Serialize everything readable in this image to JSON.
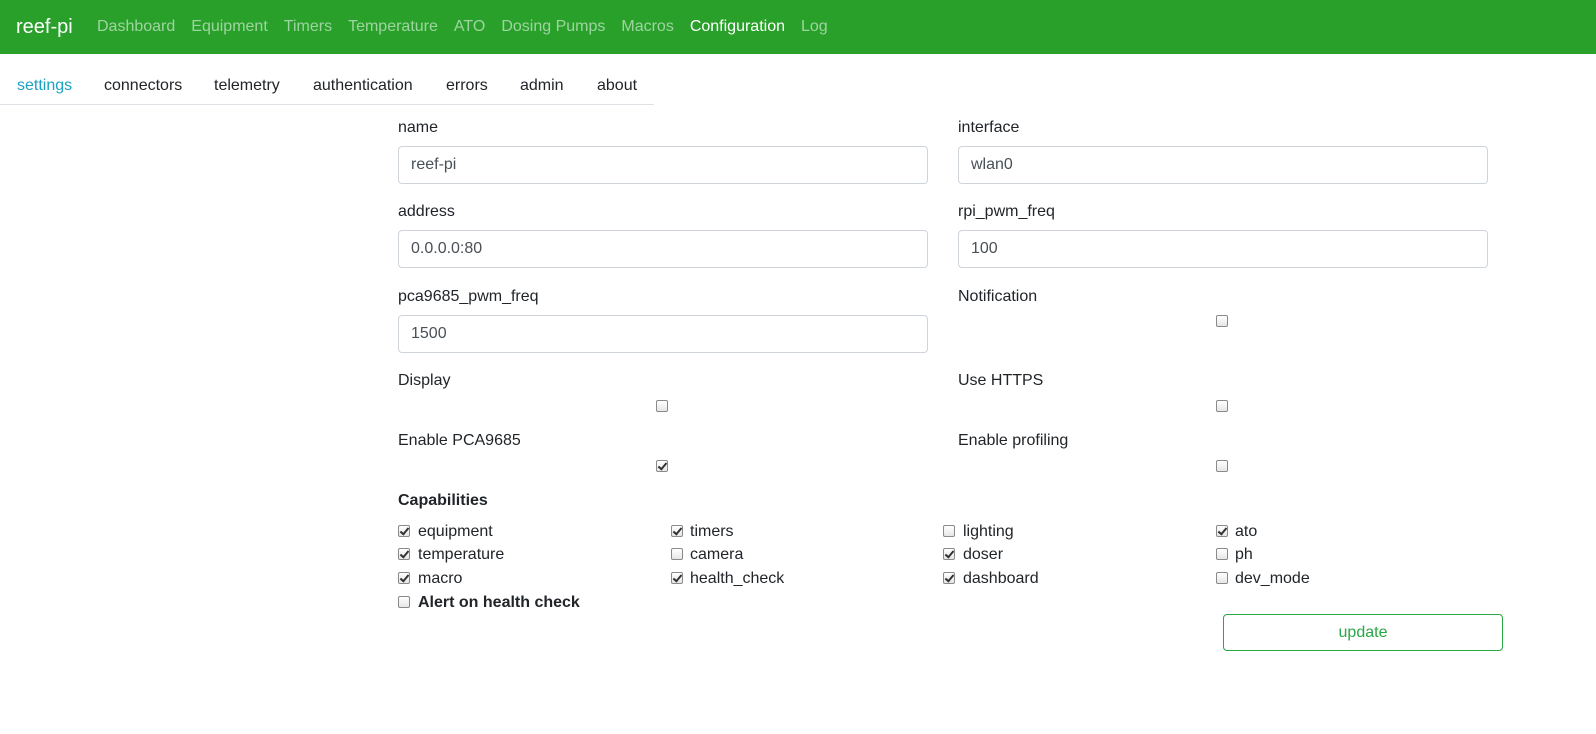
{
  "app": {
    "brand": "reef-pi",
    "nav": [
      "Dashboard",
      "Equipment",
      "Timers",
      "Temperature",
      "ATO",
      "Dosing Pumps",
      "Macros",
      "Configuration",
      "Log"
    ],
    "active_nav": "Configuration"
  },
  "tabs": {
    "items": [
      "settings",
      "connectors",
      "telemetry",
      "authentication",
      "errors",
      "admin",
      "about"
    ],
    "active": "settings"
  },
  "form": {
    "name": {
      "label": "name",
      "value": "reef-pi"
    },
    "interface": {
      "label": "interface",
      "value": "wlan0"
    },
    "address": {
      "label": "address",
      "value": "0.0.0.0:80"
    },
    "rpi_pwm_freq": {
      "label": "rpi_pwm_freq",
      "value": "100"
    },
    "pca9685_pwm_freq": {
      "label": "pca9685_pwm_freq",
      "value": "1500"
    },
    "notification": {
      "label": "Notification",
      "checked": false
    },
    "display": {
      "label": "Display",
      "checked": false
    },
    "use_https": {
      "label": "Use HTTPS",
      "checked": false
    },
    "enable_pca9685": {
      "label": "Enable PCA9685",
      "checked": true
    },
    "enable_profiling": {
      "label": "Enable profiling",
      "checked": false
    }
  },
  "capabilities": {
    "title": "Capabilities",
    "items": [
      {
        "label": "equipment",
        "checked": true
      },
      {
        "label": "timers",
        "checked": true
      },
      {
        "label": "lighting",
        "checked": false
      },
      {
        "label": "ato",
        "checked": true
      },
      {
        "label": "temperature",
        "checked": true
      },
      {
        "label": "camera",
        "checked": false
      },
      {
        "label": "doser",
        "checked": true
      },
      {
        "label": "ph",
        "checked": false
      },
      {
        "label": "macro",
        "checked": true
      },
      {
        "label": "health_check",
        "checked": true
      },
      {
        "label": "dashboard",
        "checked": true
      },
      {
        "label": "dev_mode",
        "checked": false
      }
    ],
    "alert": {
      "label": "Alert on health check",
      "checked": false
    }
  },
  "actions": {
    "update_label": "update"
  },
  "colors": {
    "navbar": "#28a02a",
    "tab_active": "#1aa2c2",
    "button": "#28a745"
  }
}
